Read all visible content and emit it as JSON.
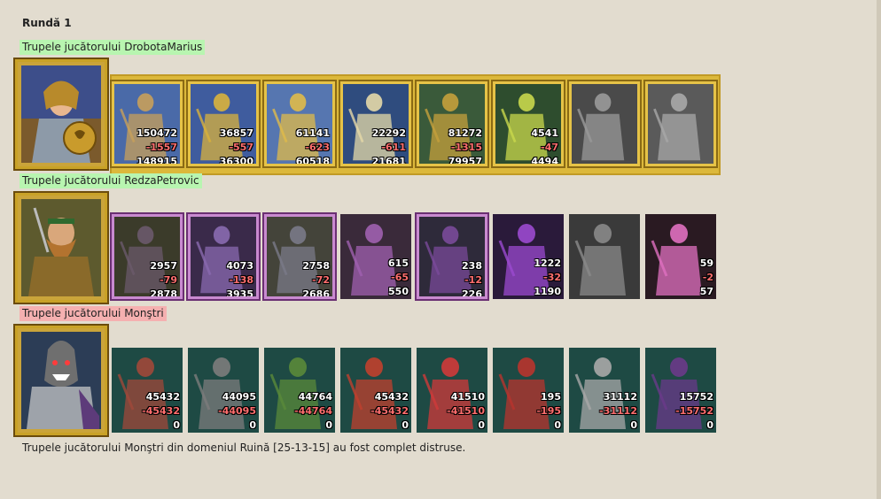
{
  "round_title": "Rundă 1",
  "colors": {
    "ally_label_bg": "#b8f5b0",
    "enemy_label_bg": "#f5b0b0",
    "loss_text": "#ff6e6e"
  },
  "players": [
    {
      "label": "Trupele jucătorului DrobotaMarius",
      "hero": "female-knight-hero",
      "units": [
        {
          "icon": "peasant-donkey",
          "before": "150472",
          "loss": "-1557",
          "after": "148915"
        },
        {
          "icon": "golden-knight",
          "before": "36857",
          "loss": "-557",
          "after": "36300"
        },
        {
          "icon": "golden-cavalry",
          "before": "61141",
          "loss": "-623",
          "after": "60518"
        },
        {
          "icon": "pegasus-rider",
          "before": "22292",
          "loss": "-611",
          "after": "21681"
        },
        {
          "icon": "crossbowman",
          "before": "81272",
          "loss": "-1315",
          "after": "79957"
        },
        {
          "icon": "green-mage",
          "before": "4541",
          "loss": "-47",
          "after": "4494"
        },
        {
          "icon": "grey-warrior-unused",
          "before": "",
          "loss": "",
          "after": ""
        },
        {
          "icon": "grey-angel-unused",
          "before": "",
          "loss": "",
          "after": ""
        }
      ]
    },
    {
      "label": "Trupele jucătorului RedzaPetrovic",
      "hero": "dwarf-warrior-hero",
      "units": [
        {
          "icon": "beast-brute",
          "before": "2957",
          "loss": "-79",
          "after": "2878"
        },
        {
          "icon": "dark-swordsman",
          "before": "4073",
          "loss": "-138",
          "after": "3935"
        },
        {
          "icon": "armored-crossbow",
          "before": "2758",
          "loss": "-72",
          "after": "2686"
        },
        {
          "icon": "purple-harpy",
          "before": "615",
          "loss": "-65",
          "after": "550"
        },
        {
          "icon": "dark-archer",
          "before": "238",
          "loss": "-12",
          "after": "226"
        },
        {
          "icon": "dark-sorceress",
          "before": "1222",
          "loss": "-32",
          "after": "1190"
        },
        {
          "icon": "grey-assassin-unused",
          "before": "",
          "loss": "",
          "after": ""
        },
        {
          "icon": "spider-rider",
          "before": "59",
          "loss": "-2",
          "after": "57"
        }
      ]
    },
    {
      "label": "Trupele jucătorului Monştri",
      "hero": "monster-chieftain-hero",
      "units": [
        {
          "icon": "lizard-warrior",
          "before": "45432",
          "loss": "-45432",
          "after": "0"
        },
        {
          "icon": "stone-golem",
          "before": "44095",
          "loss": "-44095",
          "after": "0"
        },
        {
          "icon": "orc-chief",
          "before": "44764",
          "loss": "-44764",
          "after": "0"
        },
        {
          "icon": "red-gargoyle",
          "before": "45432",
          "loss": "-45432",
          "after": "0"
        },
        {
          "icon": "fire-spider",
          "before": "41510",
          "loss": "-41510",
          "after": "0"
        },
        {
          "icon": "red-succubus",
          "before": "195",
          "loss": "-195",
          "after": "0"
        },
        {
          "icon": "blood-altar",
          "before": "31112",
          "loss": "-31112",
          "after": "0"
        },
        {
          "icon": "serpent-demon",
          "before": "15752",
          "loss": "-15752",
          "after": "0"
        }
      ]
    }
  ],
  "footer": "Trupele jucătorului Monştri din domeniul Ruină [25-13-15] au fost complet distruse."
}
